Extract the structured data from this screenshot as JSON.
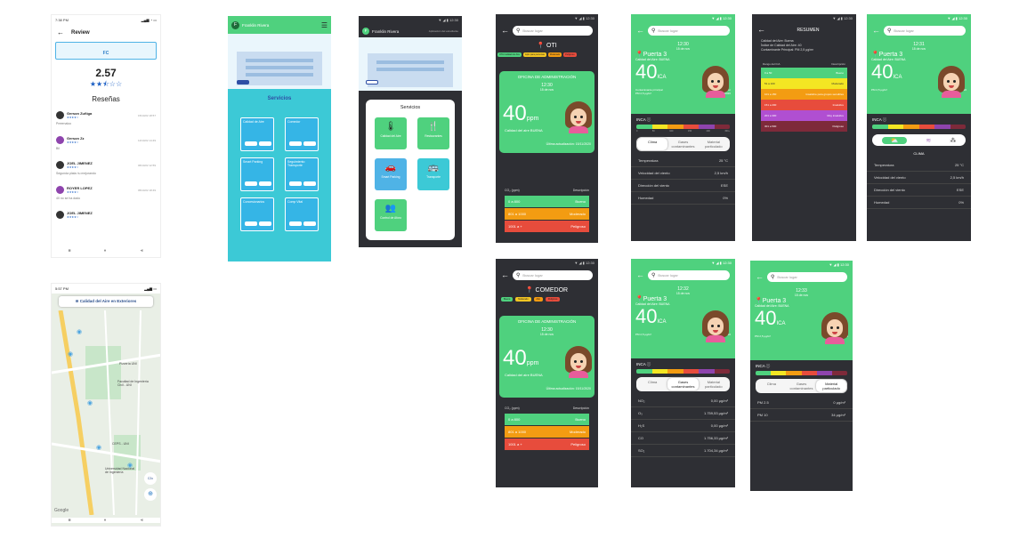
{
  "status": {
    "time1": "7:38 PM",
    "time2": "5:57 PM",
    "time3": "12:30"
  },
  "review": {
    "title": "Review",
    "fc": "FC",
    "score": "2.57",
    "heading": "Reseñas",
    "items": [
      {
        "name": "Gerson Zuñiga",
        "date": "15/10/22 18:57",
        "text": "Preernaloo"
      },
      {
        "name": "Gerson Zz",
        "date": "12/10/22 14:49",
        "text": "Bil"
      },
      {
        "name": "JOEL JIMENEZ",
        "date": "06/10/22 12:59",
        "text": "Segunda plata: tu mejorando"
      },
      {
        "name": "ROYER LOPEZ",
        "date": "05/10/22 18:49",
        "text": "40 no se ha dado"
      },
      {
        "name": "JOEL JIMENEZ",
        "date": "",
        "text": ""
      }
    ]
  },
  "mapscreen": {
    "title": "Calidad del Aire en Exteriores",
    "labels": [
      "Pizzería UNI",
      "Facultad de Ingeniería Civil - UNI",
      "CEPS - UNI",
      "Universidad Nacional de Ingeniería",
      "Google"
    ],
    "badge": "C2c"
  },
  "home1": {
    "user": "Franklin Rivera",
    "section": "Servicios",
    "tiles": [
      "Calidad de Aire",
      "Comedor",
      "Smart Parking",
      "Seguimiento Transporte",
      "Concesionarios",
      "Comp Vital"
    ]
  },
  "home2": {
    "user": "Franklin Rivera",
    "aux": "Aplicación del estudiante",
    "section": "Servicios",
    "tiles": [
      "Calidad del Aire",
      "Restaurantes",
      "Smart Parking",
      "Transporte",
      "Control de Aforo"
    ]
  },
  "oti": {
    "search": "Buscar lugar",
    "place": "OTI",
    "chips": [
      "OTA Calidad del Aire",
      "Apto para personas",
      "Moderado",
      "Peligroso"
    ],
    "card_title": "OFICINA DE ADMINISTRACIÓN",
    "time": "12:30",
    "date": "15 de nov",
    "value": "40",
    "unit": "ppm",
    "quality": "Calidad del aire BUENA",
    "updated": "Última actualización: 15/11/2020",
    "table_head": [
      "CO₂ (ppm)",
      "Descripción"
    ],
    "table": [
      [
        "0 a 800",
        "Bueno"
      ],
      [
        "801 a 1000",
        "Moderado"
      ],
      [
        "1001 a +",
        "Peligroso"
      ]
    ]
  },
  "comedor": {
    "search": "Buscar lugar",
    "place": "COMEDOR",
    "chips": [
      "Bueno",
      "Moderado",
      "Alto",
      "Peligroso"
    ],
    "card_title": "OFICINA DE ADMINISTRACIÓN",
    "time": "12:30",
    "date": "15 de nov",
    "value": "40",
    "unit": "ppm",
    "quality": "Calidad del aire BUENA",
    "updated": "Última actualización: 15/11/2020",
    "table_head": [
      "CO₂ (ppm)",
      "Descripción"
    ],
    "table": [
      [
        "0 a 800",
        "Bueno"
      ],
      [
        "801 a 1000",
        "Moderado"
      ],
      [
        "1001 a +",
        "Peligroso"
      ]
    ]
  },
  "puerta1": {
    "search": "Buscar lugar",
    "time": "12:30",
    "date": "15 de nov",
    "place": "Puerta 3",
    "quality": "Calidad del Aire: BUENA",
    "value": "40",
    "unit": "ICA",
    "pollutant_label": "Contaminante principal",
    "pollutant": "PM 2,5 μg/m³",
    "updated_label": "Última actualización",
    "updated": "15/11/2020",
    "inca": "INCA ⓘ",
    "scale": [
      "0",
      "50",
      "100",
      "150",
      "200",
      "300+"
    ],
    "tabs": [
      "Clima",
      "Gases contaminantes",
      "Material particulado"
    ],
    "rows": [
      [
        "Temperatura",
        "25 °C"
      ],
      [
        "Velocidad del viento",
        "2,5 km/h"
      ],
      [
        "Dirección del viento",
        "ESE"
      ],
      [
        "Humedad",
        "0%"
      ]
    ]
  },
  "resumen": {
    "title": "RESUMEN",
    "lines": [
      "Calidad del Aire: Buena",
      "Índice de Calidad del Aire: 40",
      "Contaminante Principal: PM 2,5 μg/m³"
    ],
    "head": [
      "Rango del ICA",
      "Descripción"
    ],
    "rows": [
      [
        "0 a 50",
        "Bueno"
      ],
      [
        "51 a 100",
        "Moderado"
      ],
      [
        "101 a 150",
        "Insalubre para grupos sensibles"
      ],
      [
        "151 a 200",
        "Insalubre"
      ],
      [
        "201 a 300",
        "Muy insalubre"
      ],
      [
        "301 a 500",
        "Peligroso"
      ]
    ]
  },
  "puerta2": {
    "search": "Buscar lugar",
    "time": "12:31",
    "date": "15 de nov",
    "place": "Puerta 3",
    "quality": "Calidad del Aire: BUENA",
    "value": "40",
    "unit": "ICA",
    "pollutant": "PM 2,5 μg/m³",
    "updated": "15/11/2020",
    "inca": "INCA ⓘ",
    "clima": "CLIMA",
    "rows": [
      [
        "Temperatura",
        "25 °C"
      ],
      [
        "Velocidad del viento",
        "2,5 km/h"
      ],
      [
        "Dirección del viento",
        "ESE"
      ],
      [
        "Humedad",
        "0%"
      ]
    ]
  },
  "puerta3": {
    "search": "Buscar lugar",
    "time": "12:32",
    "date": "15 de nov",
    "place": "Puerta 3",
    "quality": "Calidad del Aire: BUENA",
    "value": "40",
    "unit": "ICA",
    "pollutant": "PM 2,5 μg/m³",
    "updated": "15/11/2020",
    "inca": "INCA ⓘ",
    "tabs": [
      "Clima",
      "Gases contaminantes",
      "Material particulado"
    ],
    "rows": [
      [
        "NO₂",
        "0,00 μg/m³"
      ],
      [
        "O₃",
        "1.759,53 μg/m³"
      ],
      [
        "H₂S",
        "0,00 μg/m³"
      ],
      [
        "CO",
        "1.756,33 μg/m³"
      ],
      [
        "SO₂",
        "1.704,34 μg/m³"
      ]
    ]
  },
  "puerta4": {
    "search": "Buscar lugar",
    "time": "12:33",
    "date": "15 de nov",
    "place": "Puerta 3",
    "quality": "Calidad del Aire: BUENA",
    "value": "40",
    "unit": "ICA",
    "pollutant": "PM 2,5 μg/m³",
    "updated": "15/11/2020",
    "inca": "INCA ⓘ",
    "tabs": [
      "Clima",
      "Gases contaminantes",
      "Material particulado"
    ],
    "rows": [
      [
        "PM 2.5",
        "0 μg/m³"
      ],
      [
        "PM 10",
        "34 μg/m³"
      ]
    ]
  },
  "colors": {
    "green": "#4fd17e",
    "dark": "#2e2f34",
    "teal": "#3cc9d6",
    "accent": "#2f4fa5"
  }
}
